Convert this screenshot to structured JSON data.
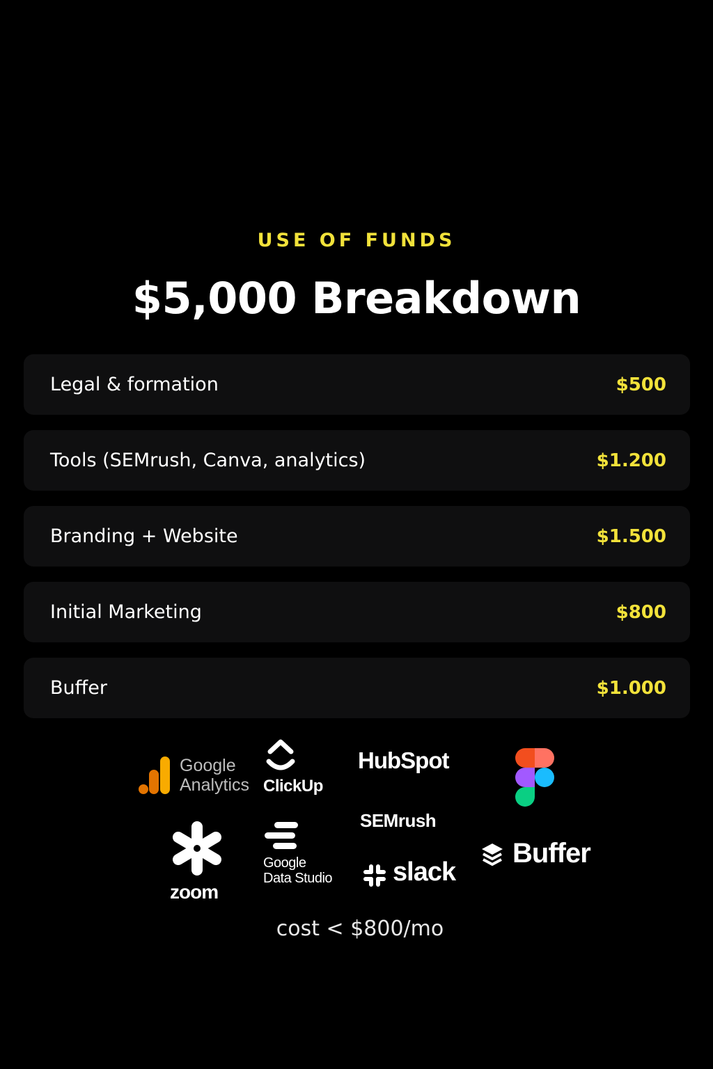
{
  "header": {
    "eyebrow": "USE OF FUNDS",
    "title": "$5,000 Breakdown"
  },
  "rows": [
    {
      "label": "Legal & formation",
      "amount": "$500"
    },
    {
      "label": "Tools (SEMrush, Canva, analytics)",
      "amount": "$1.200"
    },
    {
      "label": "Branding + Website",
      "amount": "$1.500"
    },
    {
      "label": "Initial Marketing",
      "amount": "$800"
    },
    {
      "label": "Buffer",
      "amount": "$1.000"
    }
  ],
  "logos": {
    "google_analytics": {
      "line1": "Google",
      "line2": "Analytics",
      "icon": "google-analytics-icon"
    },
    "clickup": {
      "name": "ClickUp",
      "icon": "clickup-icon"
    },
    "hubspot": {
      "name": "HubSpot",
      "icon": "hubspot-icon"
    },
    "figma": {
      "icon": "figma-icon"
    },
    "zoom": {
      "name": "zoom",
      "icon": "zoom-icon"
    },
    "google_data_studio": {
      "line1": "Google",
      "line2": "Data Studio",
      "icon": "data-studio-icon"
    },
    "semrush": {
      "name": "SEMrush"
    },
    "slack": {
      "name": "slack",
      "icon": "slack-icon"
    },
    "buffer": {
      "name": "Buffer",
      "icon": "buffer-icon"
    }
  },
  "footnote": "cost < $800/mo",
  "colors": {
    "background": "#000000",
    "accent": "#f2e23a",
    "row_bg": "#0f0f10",
    "text": "#ffffff"
  }
}
